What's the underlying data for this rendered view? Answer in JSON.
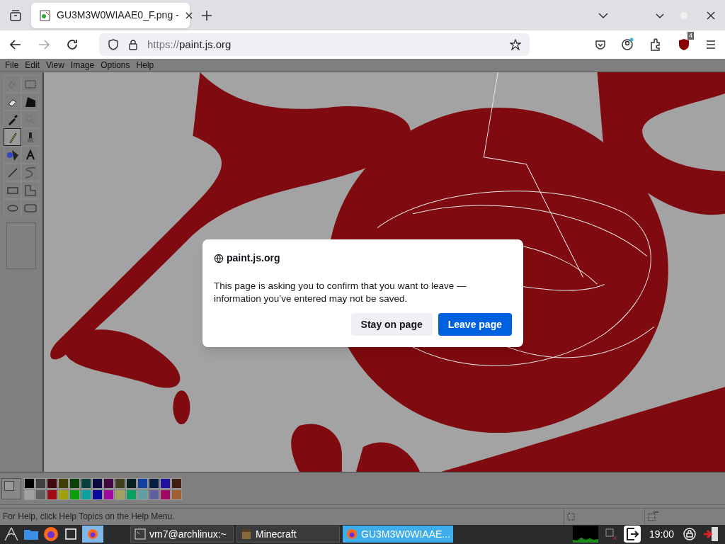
{
  "browser": {
    "tab": {
      "title": "GU3M3W0WIAAE0_F.png -",
      "selected": true
    },
    "url": {
      "scheme": "https://",
      "host": "paint.js.org"
    },
    "extension_badge": "4"
  },
  "menu": [
    "File",
    "Edit",
    "View",
    "Image",
    "Options",
    "Help"
  ],
  "tools": [
    {
      "selected": false
    },
    {
      "selected": false
    },
    {
      "selected": false
    },
    {
      "selected": false
    },
    {
      "selected": false
    },
    {
      "selected": false
    },
    {
      "selected": true
    },
    {
      "selected": false
    },
    {
      "selected": false
    },
    {
      "selected": false
    },
    {
      "selected": false
    },
    {
      "selected": false
    },
    {
      "selected": false
    },
    {
      "selected": false
    },
    {
      "selected": false
    },
    {
      "selected": false
    }
  ],
  "palette": [
    {
      "color": "#000000"
    },
    {
      "color": "#404040"
    },
    {
      "color": "#400a10"
    },
    {
      "color": "#404008"
    },
    {
      "color": "#0a400a"
    },
    {
      "color": "#0a4040"
    },
    {
      "color": "#0a0a40"
    },
    {
      "color": "#400a40"
    },
    {
      "color": "#404020"
    },
    {
      "color": "#0a2020"
    },
    {
      "color": "#1040a0"
    },
    {
      "color": "#0a2040"
    },
    {
      "color": "#2010a0"
    },
    {
      "color": "#402010"
    },
    {
      "color": "#a0a0a0"
    },
    {
      "color": "#606060"
    },
    {
      "color": "#a00a14"
    },
    {
      "color": "#a0a00a"
    },
    {
      "color": "#0aa00a"
    },
    {
      "color": "#0aa0a0"
    },
    {
      "color": "#0a0aa0"
    },
    {
      "color": "#a00aa0"
    },
    {
      "color": "#a0a060"
    },
    {
      "color": "#0aa060"
    },
    {
      "color": "#60a0a0"
    },
    {
      "color": "#6060a0"
    },
    {
      "color": "#a00a60"
    },
    {
      "color": "#a06030"
    }
  ],
  "status_bar": {
    "help": "For Help, click Help Topics on the Help Menu."
  },
  "dialog": {
    "site": "paint.js.org",
    "message": "This page is asking you to confirm that you want to leave — information you’ve entered may not be saved.",
    "buttons": [
      {
        "label": "Stay on page",
        "kind": "secondary"
      },
      {
        "label": "Leave page",
        "kind": "primary"
      }
    ]
  },
  "taskbar": {
    "tasks": [
      {
        "label": "vm7@archlinux:~",
        "selected": false,
        "kind": "terminal"
      },
      {
        "label": "Minecraft",
        "selected": false,
        "kind": "game"
      },
      {
        "label": "GU3M3W0WIAAE...",
        "selected": true,
        "kind": "browser"
      }
    ],
    "clock": "19:00"
  }
}
